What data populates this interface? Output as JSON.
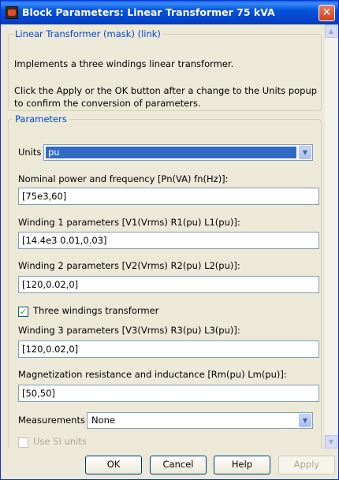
{
  "window": {
    "title": "Block Parameters: Linear Transformer 75 kVA",
    "close_glyph": "✕"
  },
  "mask_panel": {
    "legend": "Linear Transformer (mask) (link)",
    "description_line1": "Implements a three windings linear transformer.",
    "description_line2": "Click the Apply or the OK button after a change to the Units popup",
    "description_line3": "to confirm the conversion of parameters."
  },
  "parameters": {
    "legend": "Parameters",
    "units_label": "Units",
    "units_value": "pu",
    "nominal_label": "Nominal power and frequency [Pn(VA) fn(Hz)]:",
    "nominal_value": "[75e3,60]",
    "winding1_label": "Winding 1 parameters [V1(Vrms) R1(pu) L1(pu)]:",
    "winding1_value": "[14.4e3 0.01,0.03]",
    "winding2_label": "Winding 2 parameters [V2(Vrms) R2(pu) L2(pu)]:",
    "winding2_value": "[120,0.02,0]",
    "three_windings_label": "Three windings transformer",
    "three_windings_checked": true,
    "winding3_label": "Winding 3 parameters [V3(Vrms) R3(pu) L3(pu)]:",
    "winding3_value": "[120,0.02,0]",
    "magnetization_label": "Magnetization resistance and inductance [Rm(pu) Lm(pu)]:",
    "magnetization_value": "[50,50]",
    "measurements_label": "Measurements",
    "measurements_value": "None",
    "si_units_label": "Use SI units",
    "si_units_checked": false
  },
  "buttons": {
    "ok": "OK",
    "cancel": "Cancel",
    "help": "Help",
    "apply": "Apply"
  },
  "icons": {
    "app": "simulink-block-icon",
    "close": "close-icon",
    "dropdown": "chevron-down-icon",
    "check": "checkmark-icon"
  },
  "colors": {
    "titlebar": "#0453dd",
    "legend_text": "#0046d5",
    "selection": "#316ac5",
    "dialog_bg": "#ece9d8"
  }
}
